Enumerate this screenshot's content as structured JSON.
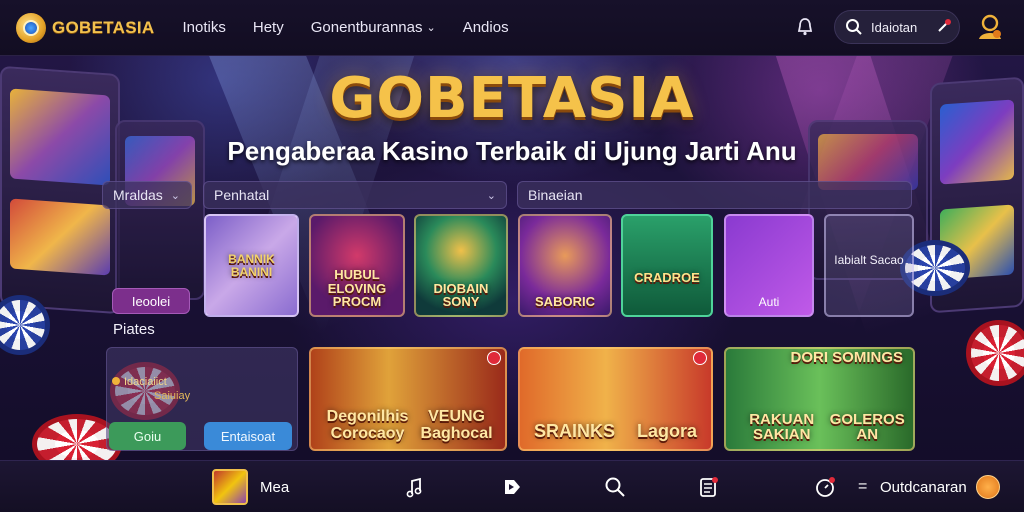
{
  "header": {
    "brand": "GOBETASIA",
    "nav": [
      "Inotiks",
      "Hety",
      "Gonentburannas",
      "Andios"
    ],
    "search_value": "Idaiotan"
  },
  "hero": {
    "title": "GOBETASIA",
    "subtitle": "Pengaberaa Kasino Terbaik di Ujung Jarti Anu"
  },
  "filters": {
    "f1": "Mraldas",
    "f2": "Penhatal",
    "f3": "Binaeian"
  },
  "side": {
    "button": "Ieoolei",
    "section_label": "Piates"
  },
  "tiles_row1": [
    {
      "label": "BANNIK BANINI"
    },
    {
      "label": "HUBUL ELOVING PROCM"
    },
    {
      "label": "DIOBAIN SONY"
    },
    {
      "label": "SABORIC"
    },
    {
      "label": "CRADROE"
    },
    {
      "label": "Auti"
    },
    {
      "label": "Iabialt Sacao"
    }
  ],
  "tiles_row2": [
    {
      "left": "Degonilhis Corocaoy",
      "right": "VEUNG Baghocal"
    },
    {
      "left": "SRAINKS",
      "right": "Lagora"
    },
    {
      "left": "RAKUAN SAKIAN",
      "right": "GOLEROS AN",
      "top": "DORI SOMINGS"
    }
  ],
  "promo": {
    "line1": "Idaciaiict",
    "line2": "Saiuiay",
    "go": "Goiu",
    "login": "Entaisoat"
  },
  "bottom": {
    "label": "Mea",
    "right_text": "Outdcanaran"
  },
  "colors": {
    "brand_gold": "#f5c24a",
    "accent_purple": "#7c2f8c",
    "go_green": "#3c9a5a",
    "login_blue": "#3a8ad8"
  }
}
